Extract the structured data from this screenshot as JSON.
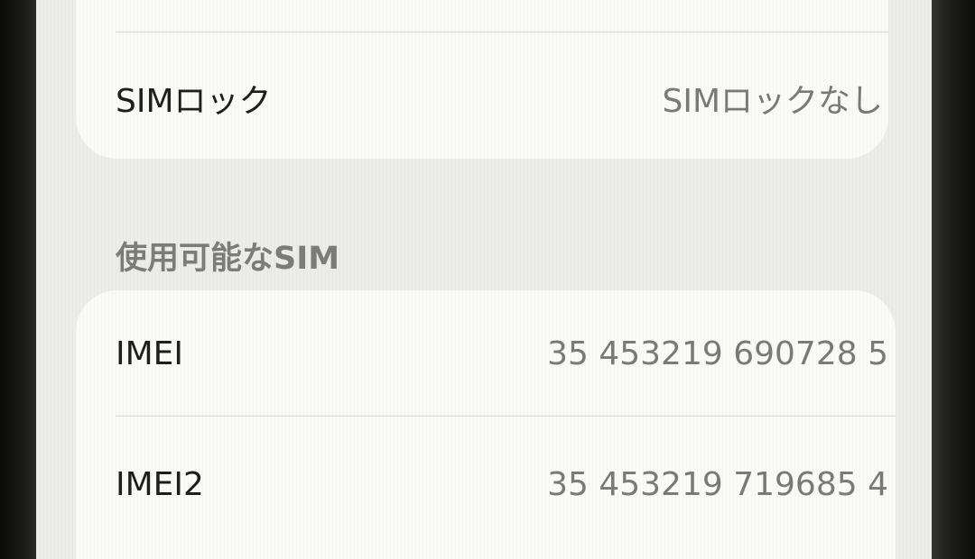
{
  "sim_lock_row": {
    "label": "SIMロック",
    "value": "SIMロックなし"
  },
  "available_sim_section": {
    "header": "使用可能なSIM",
    "rows": [
      {
        "label": "IMEI",
        "value": "35 453219 690728 5"
      },
      {
        "label": "IMEI2",
        "value": "35 453219 719685 4"
      }
    ]
  }
}
